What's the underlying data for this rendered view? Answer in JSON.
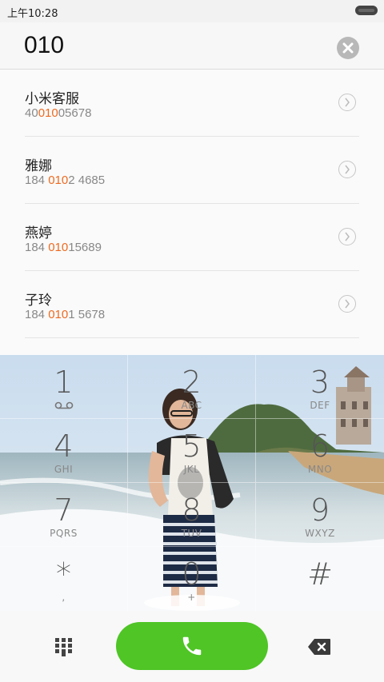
{
  "status_bar": {
    "time": "上午10:28"
  },
  "input": {
    "number": "010"
  },
  "contacts": [
    {
      "name": "小米客服",
      "phone_pre": "40",
      "phone_match": "010",
      "phone_post": "05678"
    },
    {
      "name": "雅娜",
      "phone_pre": "184 ",
      "phone_match": "010",
      "phone_post": "2 4685"
    },
    {
      "name": "燕婷",
      "phone_pre": "184 ",
      "phone_match": "010",
      "phone_post": "15689"
    },
    {
      "name": "子玲",
      "phone_pre": "184 ",
      "phone_match": "010",
      "phone_post": "1 5678"
    }
  ],
  "keys": [
    {
      "digit": "1",
      "letters": ""
    },
    {
      "digit": "2",
      "letters": "ABC"
    },
    {
      "digit": "3",
      "letters": "DEF"
    },
    {
      "digit": "4",
      "letters": "GHI"
    },
    {
      "digit": "5",
      "letters": "JKL"
    },
    {
      "digit": "6",
      "letters": "MNO"
    },
    {
      "digit": "7",
      "letters": "PQRS"
    },
    {
      "digit": "8",
      "letters": "TUV"
    },
    {
      "digit": "9",
      "letters": "WXYZ"
    },
    {
      "digit": "*",
      "letters": ","
    },
    {
      "digit": "0",
      "letters": "+"
    },
    {
      "digit": "#",
      "letters": ""
    }
  ],
  "colors": {
    "accent_match": "#ee6a1f",
    "call_button": "#4fc526"
  },
  "icons": {
    "clear": "clear-icon",
    "voicemail": "voicemail-icon",
    "dialpad": "dialpad-icon",
    "call": "phone-icon",
    "backspace": "backspace-icon",
    "details": "chevron-right-icon"
  }
}
